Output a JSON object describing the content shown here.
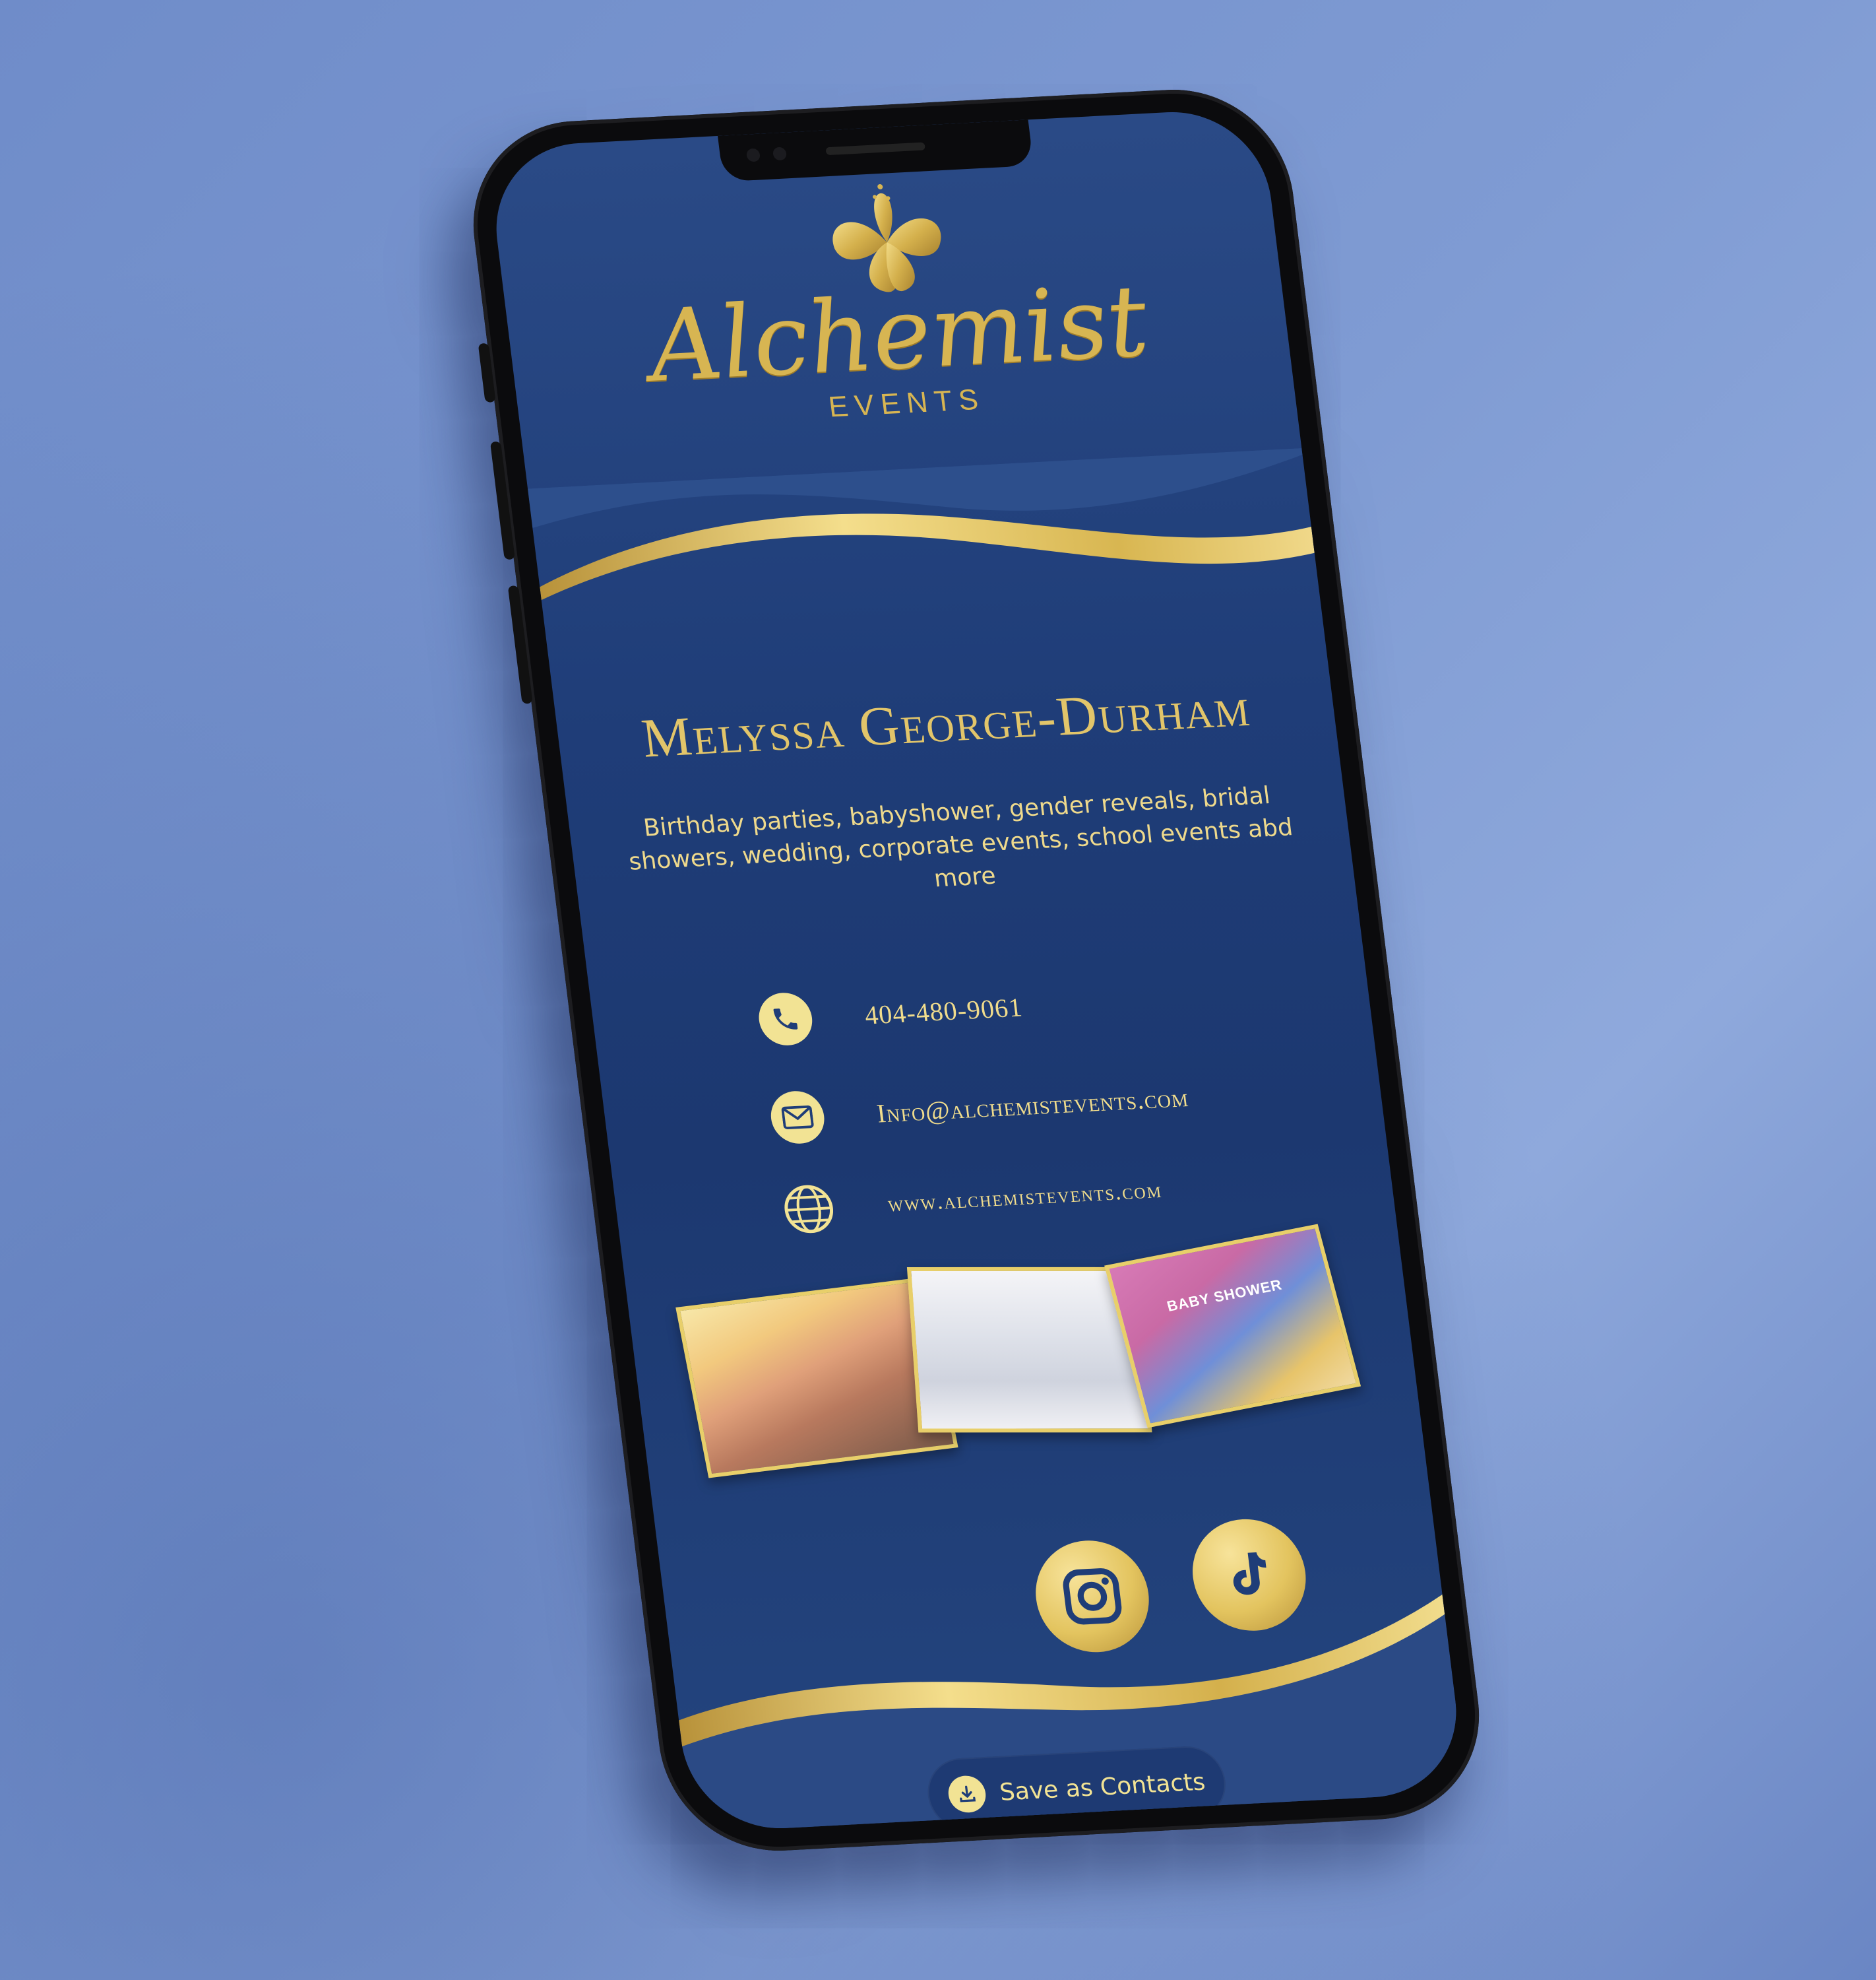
{
  "brand": {
    "logo_script": "Alchemist",
    "logo_sub": "EVENTS",
    "gold": "#d7b552",
    "navy": "#1f3d78"
  },
  "profile": {
    "name": "Melyssa George-Durham",
    "services": "Birthday parties, babyshower, gender reveals, bridal showers, wedding, corporate events, school events abd more"
  },
  "contacts": [
    {
      "icon": "phone-icon",
      "value": "404-480-9061"
    },
    {
      "icon": "mail-icon",
      "value": "Info@alchemistevents.com"
    },
    {
      "icon": "globe-icon",
      "value": "www.alchemistevents.com"
    }
  ],
  "gallery": {
    "p3_caption": "BABY SHOWER"
  },
  "social": [
    {
      "icon": "instagram-icon"
    },
    {
      "icon": "tiktok-icon"
    }
  ],
  "actions": {
    "save_label": "Save as Contacts"
  }
}
